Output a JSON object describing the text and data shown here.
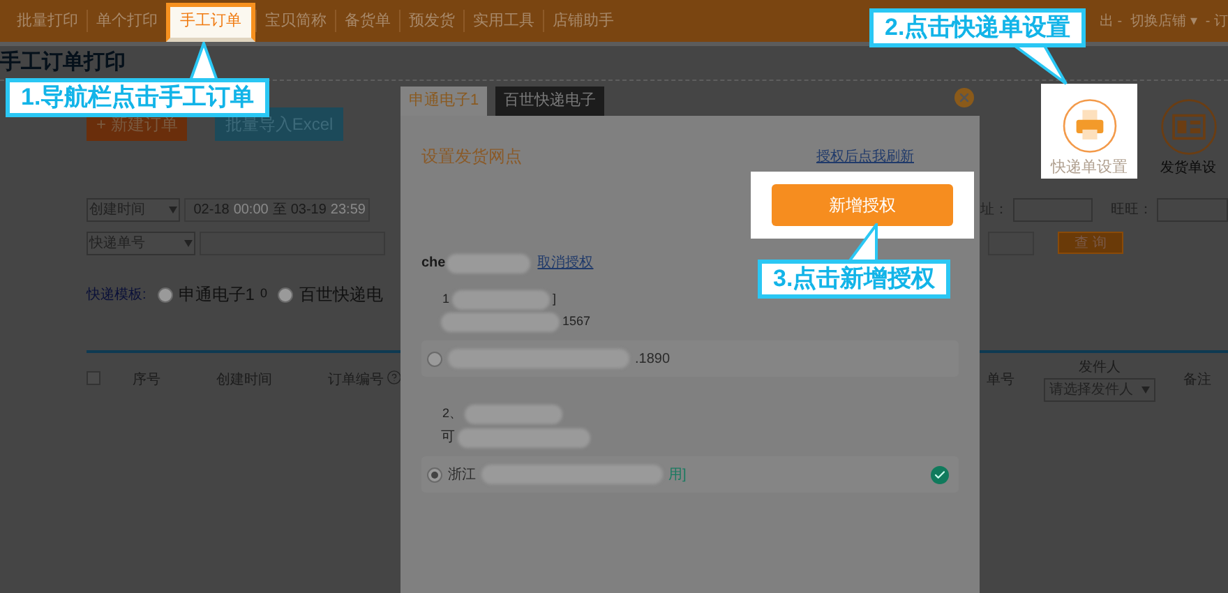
{
  "nav": {
    "items": [
      {
        "label": "批量打印",
        "selected": false
      },
      {
        "label": "单个打印",
        "selected": false
      },
      {
        "label": "手工订单",
        "selected": true
      },
      {
        "label": "宝贝简称",
        "selected": false
      },
      {
        "label": "备货单",
        "selected": false
      },
      {
        "label": "预发货",
        "selected": false
      },
      {
        "label": "实用工具",
        "selected": false
      },
      {
        "label": "店铺助手",
        "selected": false
      }
    ],
    "right_links": [
      "出 -",
      "切换店铺 ▾",
      "- 订"
    ]
  },
  "page_title": "手工订单打印",
  "buttons": [
    {
      "label": "+ 新建订单",
      "kind": "create"
    },
    {
      "label": "批量导入Excel",
      "kind": "import"
    }
  ],
  "settings_icons": [
    {
      "label": "快递单设置",
      "kind": "printer",
      "highlighted": true
    },
    {
      "label": "发货单设",
      "kind": "sheet",
      "highlighted": false
    }
  ],
  "filters": {
    "date_select": "创建时间",
    "date_parts": [
      {
        "text": "02-18",
        "dim": false
      },
      {
        "text": "00:00",
        "dim": true
      },
      {
        "text": "至",
        "dim": false
      },
      {
        "text": "03-19",
        "dim": false
      },
      {
        "text": "23:59",
        "dim": true
      }
    ],
    "number_select": "快递单号",
    "address_label": "址：",
    "wangwang_label": "旺旺：",
    "query_button": "查 询"
  },
  "template": {
    "label": "快递模板:",
    "options": [
      {
        "label": "申通电子1",
        "count": "0",
        "selected": false
      },
      {
        "label": "百世快递电",
        "selected": false
      }
    ]
  },
  "table": {
    "select_all_checked": false,
    "columns": [
      "序号",
      "创建时间",
      "订单编号",
      "单号",
      "发件人",
      "备注"
    ],
    "sender_placeholder": "请选择发件人"
  },
  "modal": {
    "tabs": [
      {
        "label": "申通电子1",
        "selected": true
      },
      {
        "label": "百世快递电子",
        "selected": false
      }
    ],
    "section_title": "设置发货网点",
    "refresh_link": "授权后点我刷新",
    "add_button": "新增授权",
    "account": "che",
    "cancel_link": "取消授权",
    "groups": [
      {
        "number": "1",
        "lines": [
          "]",
          "1567"
        ],
        "option": {
          "suffix": ".1890",
          "selected": false,
          "verified": false
        }
      },
      {
        "number": "2、",
        "lines": [
          "可"
        ],
        "option": {
          "prefix": "浙江",
          "suffix": "用]",
          "selected": true,
          "verified": true
        }
      }
    ]
  },
  "callouts": [
    "1.导航栏点击手工订单",
    "2.点击快递单设置",
    "3.点击新增授权"
  ]
}
